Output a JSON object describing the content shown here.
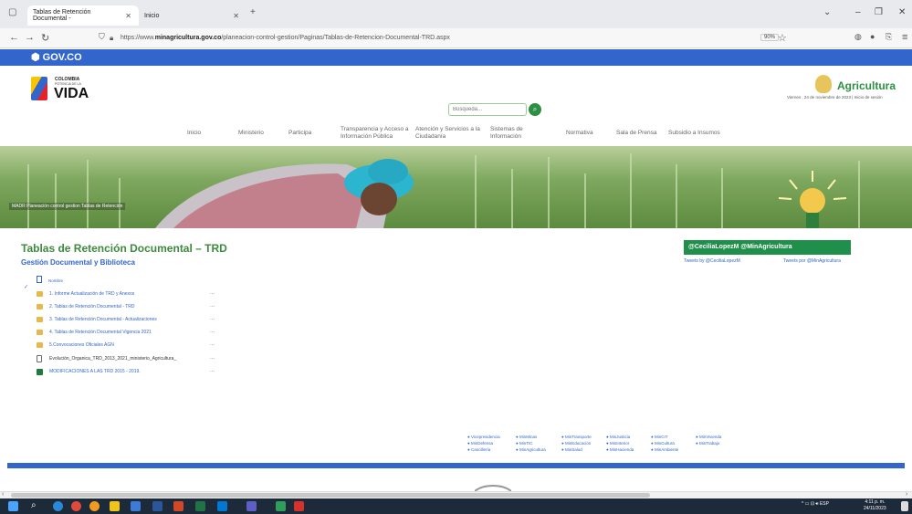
{
  "browser": {
    "tabs": [
      {
        "label": "Tablas de Retención Documental - "
      },
      {
        "label": "Inicio"
      }
    ],
    "url_prefix": "https://www.",
    "url_domain": "minagricultura.gov.co",
    "url_path": "/planeacion-control-gestion/Paginas/Tablas-de-Retencion-Documental-TRD.aspx",
    "zoom": "90%"
  },
  "gov": {
    "label": "GOV.CO"
  },
  "header": {
    "colombia_title": "COLOMBIA",
    "colombia_sub": "POTENCIA DE LA",
    "colombia_vida": "VIDA",
    "search_placeholder": "Búsqueda...",
    "ministry": "Agricultura",
    "date_line": "Viernes , 24 de noviembre de 2023  |  Inicio de sesión"
  },
  "nav": {
    "items": [
      {
        "label": "Inicio"
      },
      {
        "label": "Ministerio"
      },
      {
        "label": "Participa"
      },
      {
        "label": "Transparencia y Acceso a Información Pública"
      },
      {
        "label": "Atención y Servicios a la Ciudadanía"
      },
      {
        "label": "Sistemas de Información"
      },
      {
        "label": "Normativa"
      },
      {
        "label": "Sala de Prensa"
      },
      {
        "label": "Subsidio a Insumos"
      }
    ]
  },
  "hero": {
    "breadcrumb": "MADR  Planeación control gestion  Tablas de Retención"
  },
  "main": {
    "title": "Tablas de Retención Documental – TRD",
    "subtitle": "Gestión Documental y Biblioteca",
    "list_header": "Nombre",
    "files": [
      {
        "name": "1. Informe Actualización de TRD y Anexos",
        "type": "folder"
      },
      {
        "name": "2. Tablas de Retención Documental - TRD",
        "type": "folder"
      },
      {
        "name": "3. Tablas de Retención Documental - Actualizaciones",
        "type": "folder"
      },
      {
        "name": "4. Tablas de Retención Documental Vigencia 2021",
        "type": "folder"
      },
      {
        "name": "5.Convocaciones Oficiales AGN",
        "type": "folder"
      },
      {
        "name": "Evolución_Organica_TRD_2013_2021_ministerio_Agricultura_",
        "type": "doc"
      },
      {
        "name": "MODIFICACIONES A LAS TRD 2015 - 2019.",
        "type": "xls"
      }
    ],
    "more": "..."
  },
  "twitter": {
    "heading": "@CeciliaLopezM  @MinAgricultura",
    "link1": "Tweets by @CeciliaLopezM",
    "link2": "Tweets por @MinAgricultura"
  },
  "footer": {
    "columns": [
      [
        "Vicepresidencia",
        "MinDefensa",
        "Cancillería"
      ],
      [
        "MinMinas",
        "MinTIC",
        "MinAgricultura"
      ],
      [
        "MinTransporte",
        "MinEducación",
        "MinSalud"
      ],
      [
        "MinJusticia",
        "MinInterior",
        "MinHacienda"
      ],
      [
        "MinCIT",
        "MinCultura",
        "MinAmbiente"
      ],
      [
        "MinVivienda",
        "MinTrabajo"
      ]
    ]
  },
  "taskbar": {
    "tray": "ESP",
    "time": "4:11 p. m.",
    "date": "24/11/2023"
  }
}
